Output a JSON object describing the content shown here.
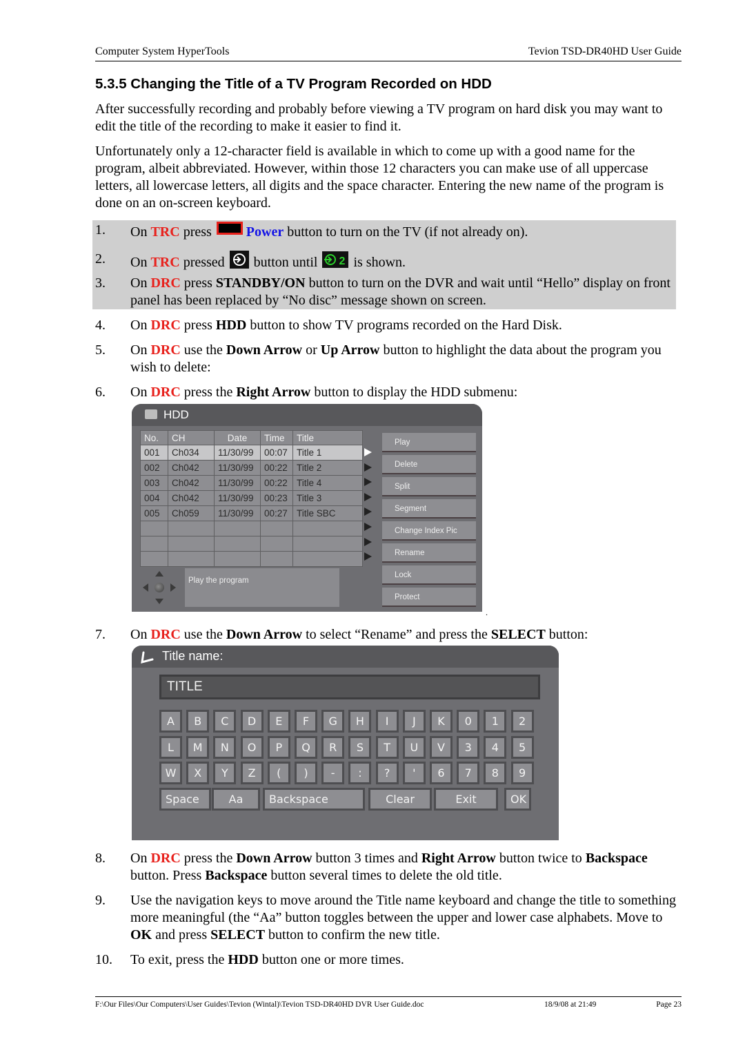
{
  "header": {
    "left": "Computer System HyperTools",
    "right": "Tevion TSD-DR40HD User Guide"
  },
  "section_title": "5.3.5  Changing the Title of a TV Program Recorded on HDD",
  "paragraphs": [
    "After successfully recording and probably before viewing a TV program on hard disk you may want to edit the title of the recording to make it easier to find it.",
    "Unfortunately only a 12-character field is available in which to come up with a good name for the program, albeit abbreviated. However, within those 12 characters you can make use of all uppercase letters, all lowercase letters, all digits and the space character. Entering the new name of the program is done on an on-screen keyboard."
  ],
  "steps": {
    "s1": {
      "num": "1.",
      "a": "On ",
      "rc": "TRC",
      "b": " press ",
      "power": "Power",
      "c": " button to turn on the TV (if not already on)."
    },
    "s2": {
      "num": "2.",
      "a": "On ",
      "rc": "TRC",
      "b": " pressed ",
      "c": " button until ",
      "src2": "2",
      "d": " is shown."
    },
    "s3": {
      "num": "3.",
      "a": "On ",
      "rc": "DRC",
      "b": " press ",
      "k1": "STANDBY/ON",
      "c": " button to turn on the DVR and wait until “Hello” display on front panel has been replaced by “No disc” message shown on screen."
    },
    "s4": {
      "num": "4.",
      "a": "On ",
      "rc": "DRC",
      "b": " press ",
      "k1": "HDD",
      "c": " button to show TV programs recorded on the Hard Disk."
    },
    "s5": {
      "num": "5.",
      "a": "On ",
      "rc": "DRC",
      "b": " use the ",
      "k1": "Down Arrow",
      "c": " or ",
      "k2": "Up Arrow",
      "d": " button to highlight the data about the program you wish to delete:"
    },
    "s6": {
      "num": "6.",
      "a": "On ",
      "rc": "DRC",
      "b": " press the ",
      "k1": "Right Arrow",
      "c": " button to display the HDD submenu:"
    },
    "s7": {
      "num": "7.",
      "a": "On ",
      "rc": "DRC",
      "b": " use the ",
      "k1": "Down Arrow",
      "c": " to select “Rename” and press the ",
      "k2": "SELECT",
      "d": " button:"
    },
    "s8": {
      "num": "8.",
      "a": "On ",
      "rc": "DRC",
      "b": " press the ",
      "k1": "Down Arrow",
      "c": " button 3 times and ",
      "k2": "Right Arrow",
      "d": " button twice to ",
      "k3": "Backspace",
      "e": " button. Press ",
      "k4": "Backspace",
      "f": " button several times to delete the old title."
    },
    "s9": {
      "num": "9.",
      "a": "Use the navigation keys to move around the Title name keyboard and change the title to something more meaningful (the “Aa” button toggles between the upper and lower case alphabets. Move to ",
      "k1": "OK",
      "b": " and press ",
      "k2": "SELECT",
      "c": " button to confirm the new title."
    },
    "s10": {
      "num": "10.",
      "a": "To exit, press the ",
      "k1": "HDD",
      "b": " button one or more times."
    }
  },
  "hdd_screen": {
    "title": "HDD",
    "columns": [
      "No.",
      "CH",
      "Date",
      "Time",
      "Title"
    ],
    "rows": [
      [
        "001",
        "Ch034",
        "11/30/99",
        "00:07",
        "Title 1"
      ],
      [
        "002",
        "Ch042",
        "11/30/99",
        "00:22",
        "Title 2"
      ],
      [
        "003",
        "Ch042",
        "11/30/99",
        "00:22",
        "Title 4"
      ],
      [
        "004",
        "Ch042",
        "11/30/99",
        "00:23",
        "Title 3"
      ],
      [
        "005",
        "Ch059",
        "11/30/99",
        "00:27",
        "Title SBC"
      ],
      [
        "",
        "",
        "",
        "",
        ""
      ],
      [
        "",
        "",
        "",
        "",
        ""
      ],
      [
        "",
        "",
        "",
        "",
        ""
      ]
    ],
    "selected_row": 0,
    "menu": [
      "Play",
      "Delete",
      "Split",
      "Segment",
      "Change Index Pic",
      "Rename",
      "Lock",
      "Protect"
    ],
    "help_text": "Play the program"
  },
  "keyboard_screen": {
    "title": "Title name:",
    "field_value": "TITLE",
    "rows": [
      [
        "A",
        "B",
        "C",
        "D",
        "E",
        "F",
        "G",
        "H",
        "I",
        "J",
        "K",
        "0",
        "1",
        "2"
      ],
      [
        "L",
        "M",
        "N",
        "O",
        "P",
        "Q",
        "R",
        "S",
        "T",
        "U",
        "V",
        "3",
        "4",
        "5"
      ],
      [
        "W",
        "X",
        "Y",
        "Z",
        "(",
        ")",
        "-",
        ":",
        "?",
        "'",
        "6",
        "7",
        "8",
        "9"
      ]
    ],
    "function_keys": [
      "Space",
      "Aa",
      "Backspace",
      "Clear",
      "Exit",
      "OK"
    ]
  },
  "footer": {
    "path": "F:\\Our Files\\Our Computers\\User Guides\\Tevion (Wintal)\\Tevion TSD-DR40HD DVR User Guide.doc",
    "date": "18/9/08 at 21:49",
    "page": "Page 23"
  }
}
